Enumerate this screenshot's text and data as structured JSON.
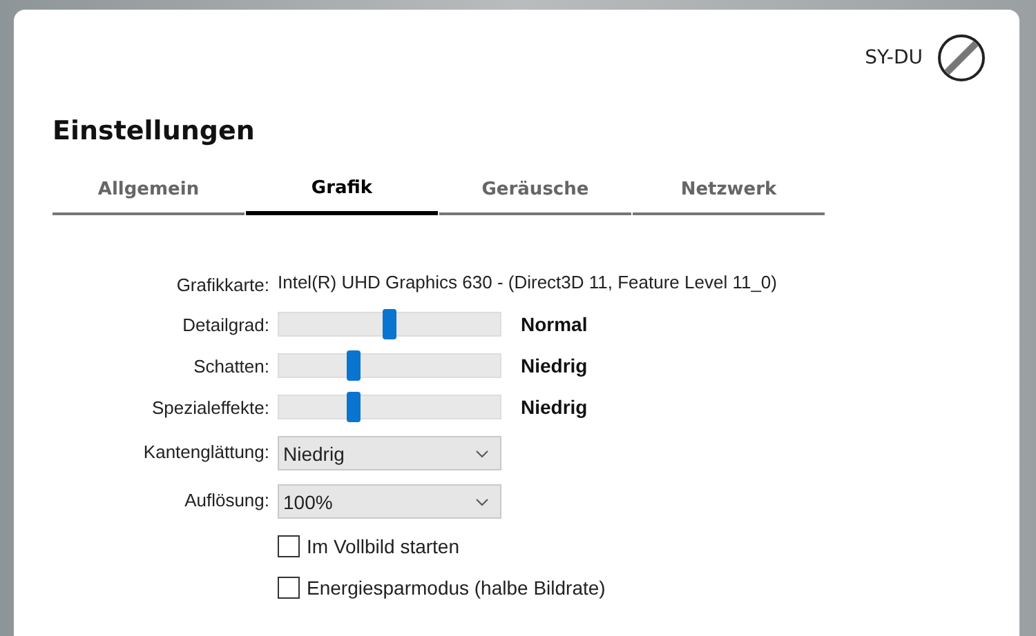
{
  "user": {
    "name": "SY-DU"
  },
  "title": "Einstellungen",
  "tabs": [
    {
      "label": "Allgemein",
      "selected": false
    },
    {
      "label": "Grafik",
      "selected": true
    },
    {
      "label": "Geräusche",
      "selected": false
    },
    {
      "label": "Netzwerk",
      "selected": false
    }
  ],
  "rows": [
    {
      "kind": "info",
      "label": "Grafikkarte:",
      "value": "Intel(R) UHD Graphics 630 - (Direct3D 11, Feature Level 11_0)"
    },
    {
      "kind": "slider",
      "label": "Detailgrad:",
      "level": 0.5,
      "reading": "Normal"
    },
    {
      "kind": "slider",
      "label": "Schatten:",
      "level": 0.34,
      "reading": "Niedrig"
    },
    {
      "kind": "slider",
      "label": "Spezialeffekte:",
      "level": 0.34,
      "reading": "Niedrig"
    },
    {
      "kind": "dropdown",
      "label": "Kantenglättung:",
      "value": "Niedrig"
    },
    {
      "kind": "dropdown",
      "label": "Auflösung:",
      "value": "100%"
    },
    {
      "kind": "checkbox",
      "text": "Im Vollbild starten",
      "checked": false
    },
    {
      "kind": "checkbox",
      "text": "Energiesparmodus (halbe Bildrate)",
      "checked": false
    }
  ]
}
